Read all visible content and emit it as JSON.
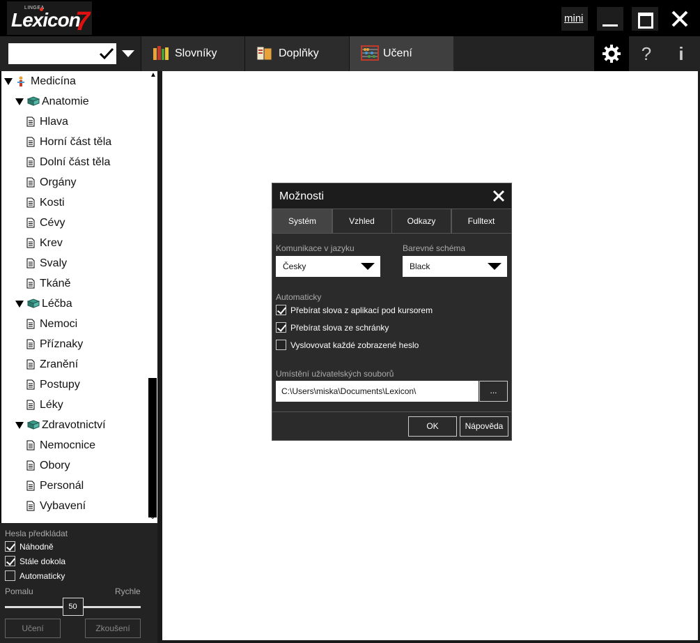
{
  "app": {
    "logo_brand": "LINGEA",
    "logo_name": "Lexicon",
    "logo_version": "7",
    "mini_label": "mini"
  },
  "toolbar": {
    "search_value": "",
    "tabs": [
      {
        "label": "Slovníky",
        "icon": "books-icon"
      },
      {
        "label": "Doplňky",
        "icon": "addons-icon"
      },
      {
        "label": "Učení",
        "icon": "abacus-icon"
      }
    ],
    "help_label": "?",
    "info_label": "i"
  },
  "tree": {
    "items": [
      {
        "label": "Medicína",
        "level": 0,
        "kind": "root"
      },
      {
        "label": "Anatomie",
        "level": 1,
        "kind": "book"
      },
      {
        "label": "Hlava",
        "level": 2,
        "kind": "page"
      },
      {
        "label": "Horní část těla",
        "level": 2,
        "kind": "page"
      },
      {
        "label": "Dolní část těla",
        "level": 2,
        "kind": "page"
      },
      {
        "label": "Orgány",
        "level": 2,
        "kind": "page"
      },
      {
        "label": "Kosti",
        "level": 2,
        "kind": "page"
      },
      {
        "label": "Cévy",
        "level": 2,
        "kind": "page"
      },
      {
        "label": "Krev",
        "level": 2,
        "kind": "page"
      },
      {
        "label": "Svaly",
        "level": 2,
        "kind": "page"
      },
      {
        "label": "Tkáně",
        "level": 2,
        "kind": "page"
      },
      {
        "label": "Léčba",
        "level": 1,
        "kind": "book"
      },
      {
        "label": "Nemoci",
        "level": 2,
        "kind": "page"
      },
      {
        "label": "Příznaky",
        "level": 2,
        "kind": "page"
      },
      {
        "label": "Zranění",
        "level": 2,
        "kind": "page"
      },
      {
        "label": "Postupy",
        "level": 2,
        "kind": "page"
      },
      {
        "label": "Léky",
        "level": 2,
        "kind": "page"
      },
      {
        "label": "Zdravotnictví",
        "level": 1,
        "kind": "book"
      },
      {
        "label": "Nemocnice",
        "level": 2,
        "kind": "page"
      },
      {
        "label": "Obory",
        "level": 2,
        "kind": "page"
      },
      {
        "label": "Personál",
        "level": 2,
        "kind": "page"
      },
      {
        "label": "Vybavení",
        "level": 2,
        "kind": "page"
      }
    ]
  },
  "learn": {
    "title": "Hesla předkládat",
    "options": [
      {
        "label": "Náhodně",
        "checked": true
      },
      {
        "label": "Stále dokola",
        "checked": true
      },
      {
        "label": "Automaticky",
        "checked": false
      }
    ],
    "slow_label": "Pomalu",
    "fast_label": "Rychle",
    "speed_value": "50",
    "speed_fraction": 0.5,
    "learn_button": "Učení",
    "test_button": "Zkoušení"
  },
  "dialog": {
    "title": "Možnosti",
    "tabs": [
      "Systém",
      "Vzhled",
      "Odkazy",
      "Fulltext"
    ],
    "active_tab": 0,
    "language_label": "Komunikace v jazyku",
    "language_value": "Česky",
    "scheme_label": "Barevné schéma",
    "scheme_value": "Black",
    "auto_label": "Automaticky",
    "options": [
      {
        "label": "Přebírat slova z aplikací pod kursorem",
        "checked": true
      },
      {
        "label": "Přebírat slova ze schránky",
        "checked": true
      },
      {
        "label": "Vyslovovat každé zobrazené heslo",
        "checked": false
      }
    ],
    "path_label": "Umístění uživatelských souborů",
    "path_value": "C:\\Users\\miska\\Documents\\Lexicon\\",
    "browse_label": "...",
    "ok_label": "OK",
    "help_label": "Nápověda"
  },
  "colors": {
    "background": "#000000",
    "panel": "#232323",
    "active_tab": "#3f3f3f",
    "logo_accent": "#dd1111"
  }
}
